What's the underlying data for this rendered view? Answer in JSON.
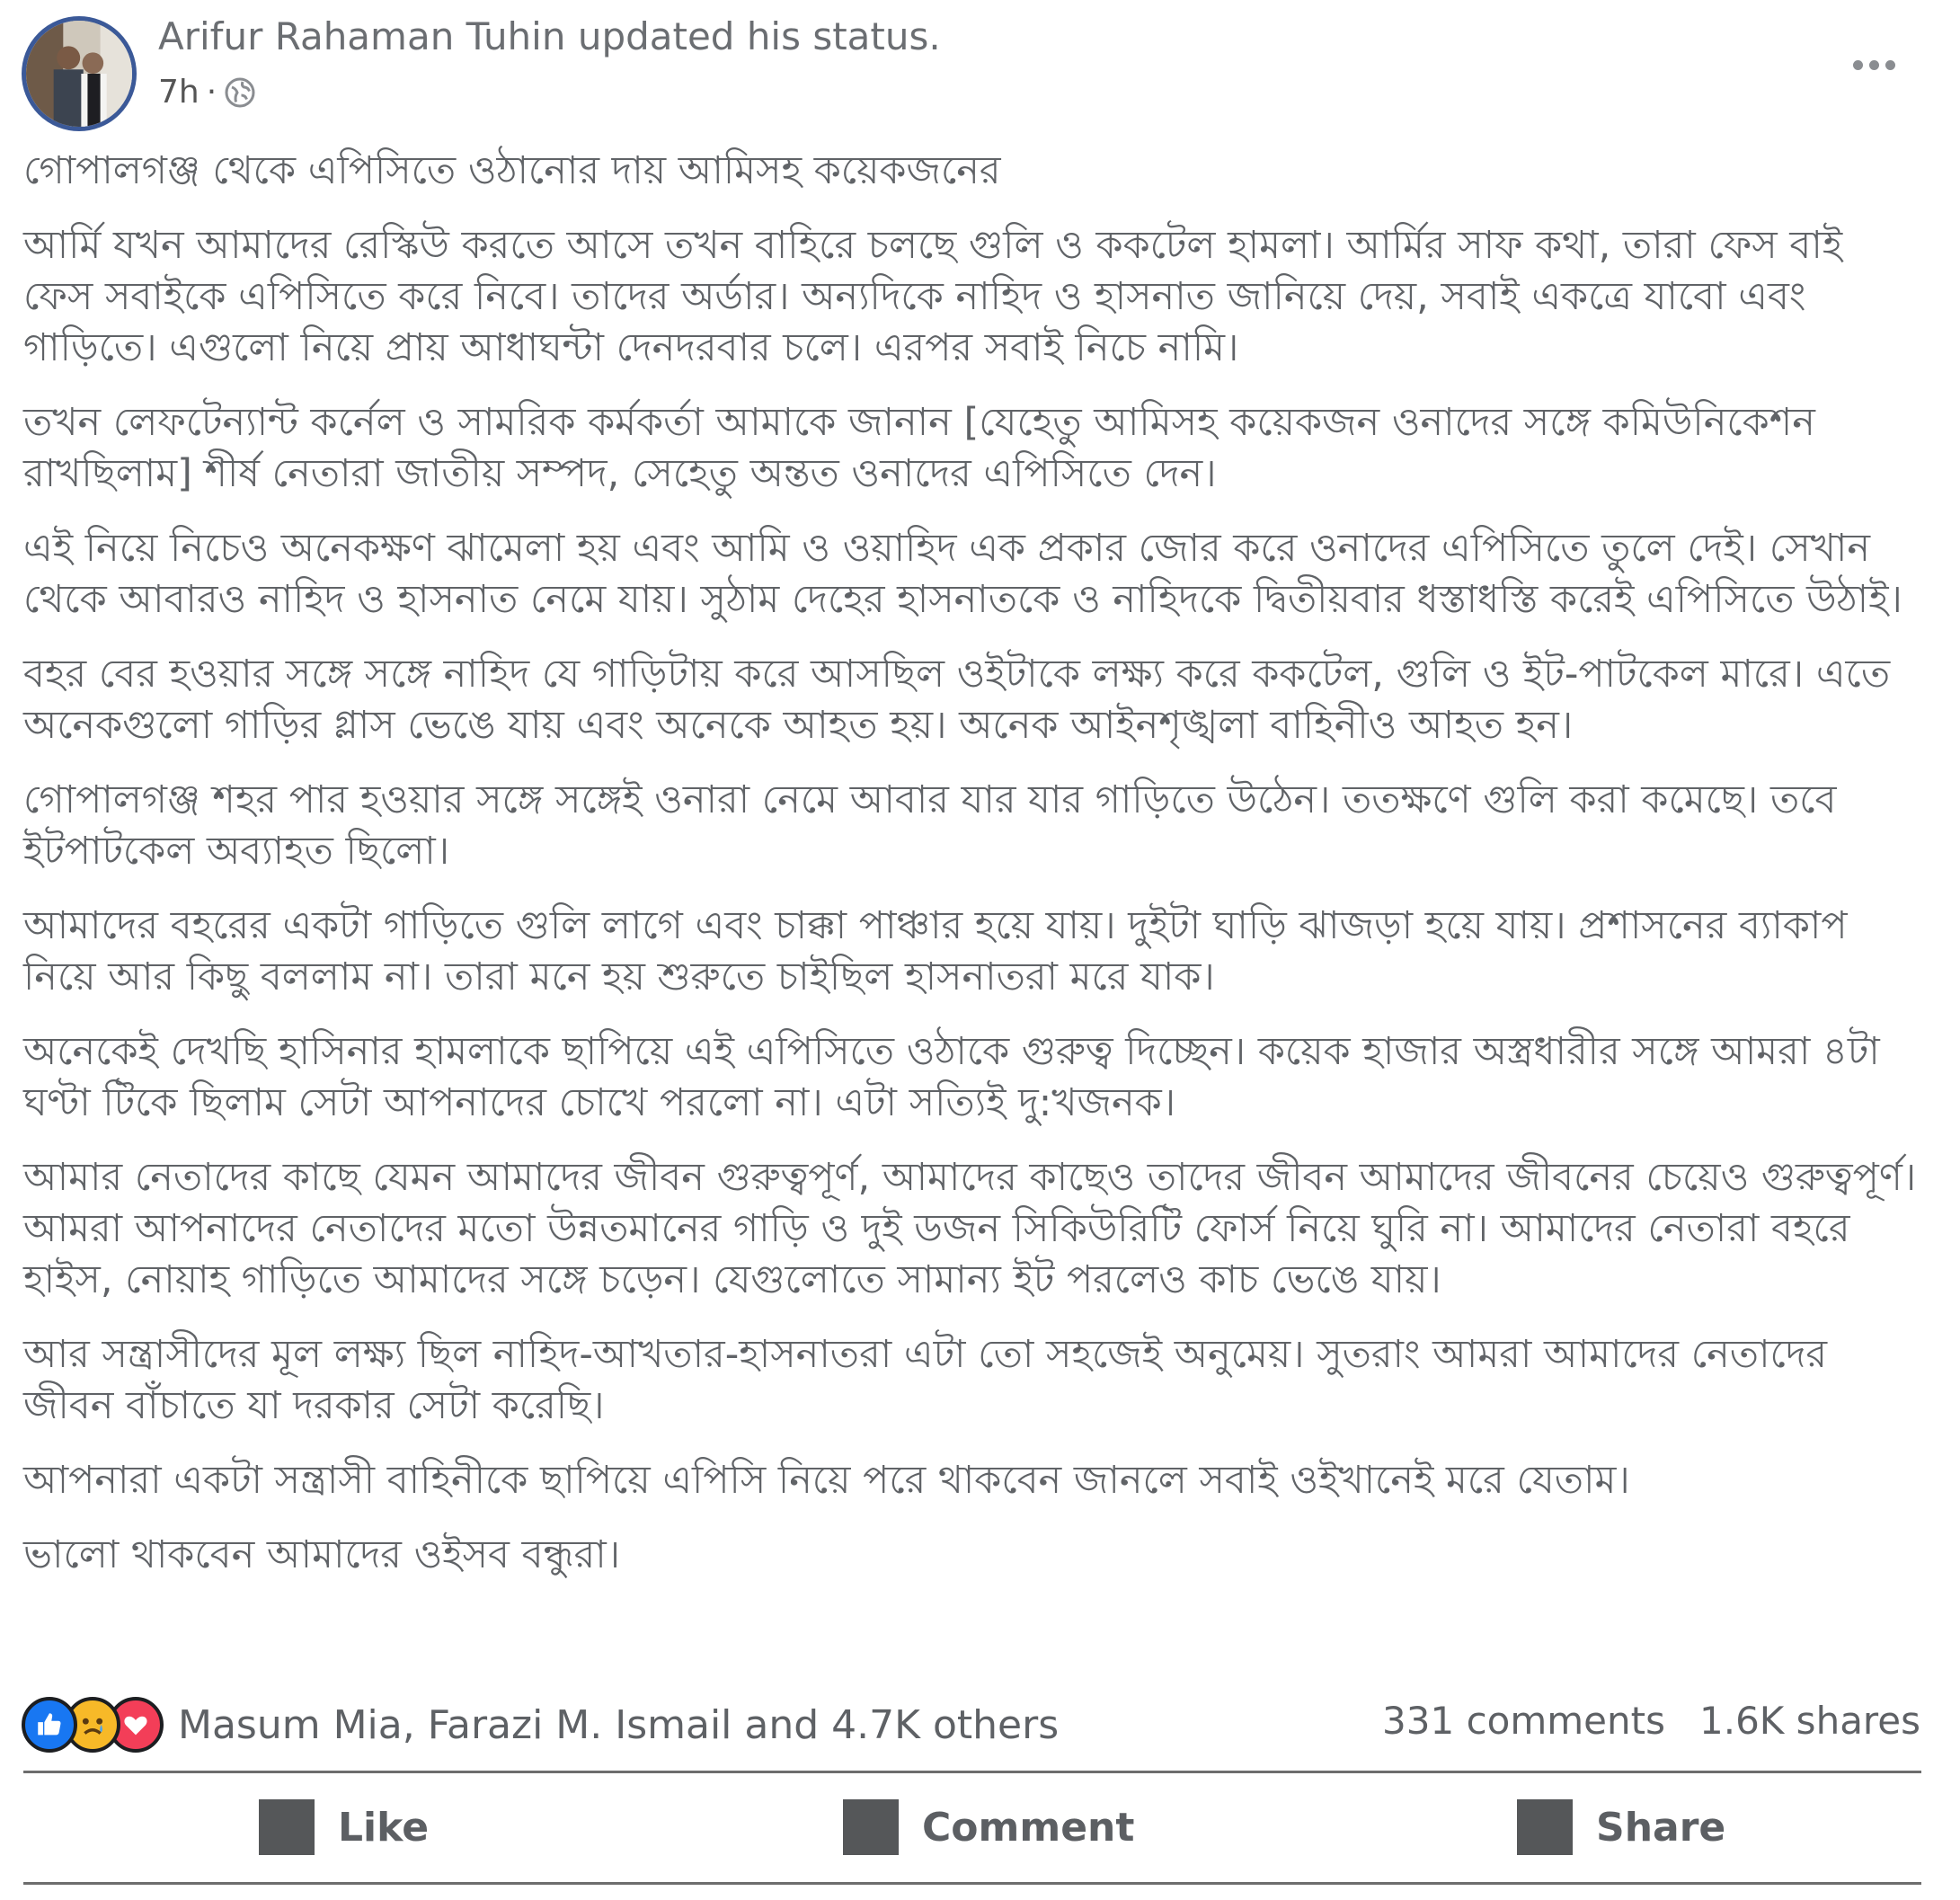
{
  "post": {
    "author_line": "Arifur Rahaman Tuhin updated his status.",
    "time": "7h",
    "separator": "·",
    "paragraphs": [
      "গোপালগঞ্জ থেকে এপিসিতে ওঠানোর দায় আমিসহ কয়েকজনের",
      "আর্মি যখন আমাদের রেস্কিউ করতে আসে তখন বাহিরে চলছে গুলি ও ককটেল হামলা। আর্মির সাফ কথা, তারা ফেস বাই ফেস সবাইকে এপিসিতে করে নিবে। তাদের অর্ডার। অন্যদিকে নাহিদ ও হাসনাত জানিয়ে দেয়, সবাই একত্রে যাবো এবং গাড়িতে। এগুলো নিয়ে প্রায় আধাঘন্টা দেনদরবার চলে। এরপর সবাই নিচে নামি।",
      "তখন লেফটেন্যান্ট কর্নেল ও সামরিক কর্মকর্তা আমাকে জানান [যেহেতু আমিসহ কয়েকজন ওনাদের সঙ্গে কমিউনিকেশন রাখছিলাম] শীর্ষ নেতারা জাতীয় সম্পদ, সেহেতু অন্তত ওনাদের এপিসিতে দেন।",
      "এই নিয়ে নিচেও অনেকক্ষণ ঝামেলা হয় এবং আমি ও ওয়াহিদ এক প্রকার জোর করে ওনাদের এপিসিতে তুলে দেই। সেখান থেকে আবারও নাহিদ ও হাসনাত নেমে যায়। সুঠাম দেহের হাসনাতকে ও নাহিদকে দ্বিতীয়বার ধস্তাধস্তি করেই এপিসিতে উঠাই।",
      "বহর বের হওয়ার সঙ্গে সঙ্গে নাহিদ যে গাড়িটায় করে আসছিল ওইটাকে লক্ষ্য করে ককটেল, গুলি ও ইট-পাটকেল মারে। এতে অনেকগুলো গাড়ির গ্লাস ভেঙে যায় এবং অনেকে আহত হয়। অনেক আইনশৃঙ্খলা বাহিনীও আহত হন।",
      "গোপালগঞ্জ শহর পার হওয়ার সঙ্গে সঙ্গেই ওনারা নেমে আবার যার যার গাড়িতে উঠেন। ততক্ষণে গুলি করা কমেছে। তবে ইটপাটকেল অব্যাহত ছিলো।",
      "আমাদের বহরের একটা গাড়িতে গুলি লাগে এবং চাক্কা পাঞ্চার হয়ে যায়। দুইটা ঘাড়ি ঝাজড়া হয়ে যায়। প্রশাসনের ব্যাকাপ নিয়ে আর কিছু বললাম না। তারা মনে হয় শুরুতে চাইছিল হাসনাতরা মরে যাক।",
      "অনেকেই দেখছি হাসিনার হামলাকে ছাপিয়ে এই এপিসিতে ওঠাকে গুরুত্ব দিচ্ছেন। কয়েক হাজার অস্ত্রধারীর সঙ্গে আমরা ৪টা ঘণ্টা টিকে ছিলাম সেটা আপনাদের চোখে পরলো না। এটা সত্যিই দু:খজনক।",
      "আমার নেতাদের কাছে যেমন আমাদের জীবন গুরুত্বপূর্ণ, আমাদের কাছেও তাদের জীবন আমাদের জীবনের চেয়েও গুরুত্বপূর্ণ। আমরা আপনাদের নেতাদের মতো উন্নতমানের গাড়ি ও দুই ডজন সিকিউরিটি ফোর্স নিয়ে ঘুরি না। আমাদের নেতারা বহরে হাইস, নোয়াহ গাড়িতে আমাদের সঙ্গে চড়েন। যেগুলোতে সামান্য ইট পরলেও কাচ ভেঙে যায়।",
      "আর সন্ত্রাসীদের মূল লক্ষ্য ছিল নাহিদ-আখতার-হাসনাতরা এটা তো সহজেই অনুমেয়। সুতরাং আমরা আমাদের নেতাদের জীবন বাঁচাতে যা দরকার সেটা করেছি।",
      "আপনারা একটা সন্ত্রাসী বাহিনীকে ছাপিয়ে এপিসি নিয়ে পরে থাকবেন জানলে সবাই ওইখানেই মরে যেতাম।",
      "ভালো থাকবেন আমাদের ওইসব বন্ধুরা।"
    ],
    "reactors": "Masum Mia, Farazi M. Ismail and 4.7K others",
    "comments_count": "331 comments",
    "shares_count": "1.6K shares",
    "actions": {
      "like": "Like",
      "comment": "Comment",
      "share": "Share"
    },
    "reaction_icons": [
      "like-icon",
      "sad-icon",
      "love-icon"
    ],
    "colors": {
      "avatar_ring": "#3b5998",
      "like": "#1877f2",
      "sad": "#f7b928",
      "love": "#f33e58"
    }
  }
}
